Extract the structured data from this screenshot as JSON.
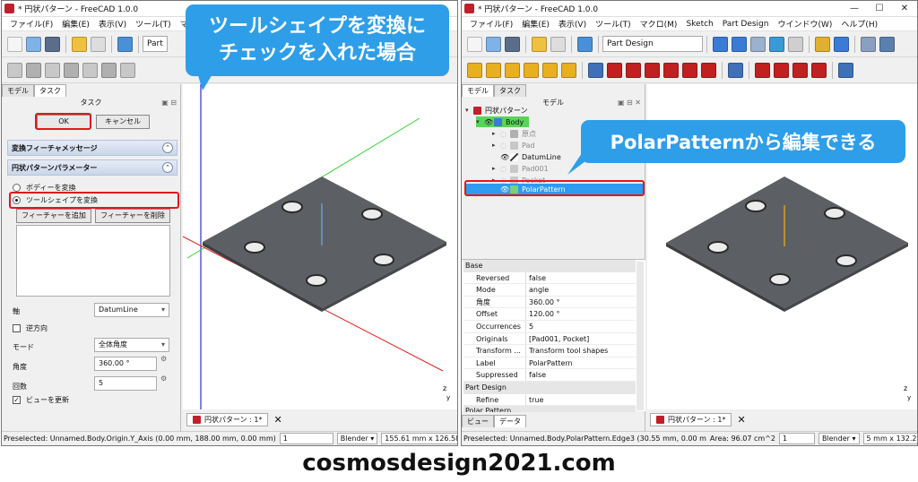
{
  "left": {
    "title": "* 円状パターン - FreeCAD 1.0.0",
    "menu": [
      "ファイル(F)",
      "編集(E)",
      "表示(V)",
      "ツール(T)",
      "マクロ(M)",
      "Sk"
    ],
    "workbench": "Part",
    "tabs": [
      "モデル",
      "タスク"
    ],
    "panel_title": "タスク",
    "ok": "OK",
    "cancel": "キャンセル",
    "section1": "変換フィーチャメッセージ",
    "section2": "円状パターンパラメーター",
    "radio_body": "ボディーを変換",
    "radio_tool": "ツールシェイプを変換",
    "add_feature": "フィーチャーを追加",
    "remove_feature": "フィーチャーを削除",
    "axis_label": "軸",
    "axis_value": "DatumLine",
    "reverse": "逆方向",
    "mode_label": "モード",
    "mode_value": "全体角度",
    "angle_label": "角度",
    "angle_value": "360.00 °",
    "count_label": "回数",
    "count_value": "5",
    "update_view": "ビューを更新",
    "doc_tab": "円状パターン : 1*",
    "status": "Preselected: Unnamed.Body.Origin.Y_Axis (0.00 mm, 188.00 mm, 0.00 mm)",
    "status_combo": "1",
    "nav_style": "Blender",
    "dimensions": "155.61 mm x 126.58 mm",
    "callout": "ツールシェイプを変換に\nチェックを入れた場合"
  },
  "right": {
    "title": "* 円状パターン - FreeCAD 1.0.0",
    "menu": [
      "ファイル(F)",
      "編集(E)",
      "表示(V)",
      "ツール(T)",
      "マクロ(M)",
      "Sketch",
      "Part Design",
      "ウインドウ(W)",
      "ヘルプ(H)"
    ],
    "workbench": "Part Design",
    "tabs": [
      "モデル",
      "タスク"
    ],
    "panel_title": "モデル",
    "tree": {
      "doc": "円状パターン",
      "body": "Body",
      "origin": "原点",
      "pad": "Pad",
      "datum": "DatumLine",
      "pad001": "Pad001",
      "pocket": "Pocket",
      "polar": "PolarPattern"
    },
    "props": {
      "group_base": "Base",
      "rows": [
        {
          "k": "Reversed",
          "v": "false"
        },
        {
          "k": "Mode",
          "v": "angle"
        },
        {
          "k": "角度",
          "v": "360.00 °"
        },
        {
          "k": "Offset",
          "v": "120.00 °"
        },
        {
          "k": "Occurrences",
          "v": "5"
        },
        {
          "k": "Originals",
          "v": "[Pad001, Pocket]"
        },
        {
          "k": "Transform ...",
          "v": "Transform tool shapes"
        },
        {
          "k": "Label",
          "v": "PolarPattern"
        },
        {
          "k": "Suppressed",
          "v": "false"
        }
      ],
      "group_pd": "Part Design",
      "refine_k": "Refine",
      "refine_v": "true",
      "group_polar": "Polar Pattern"
    },
    "bottom_tabs": [
      "ビュー",
      "データ"
    ],
    "doc_tab": "円状パターン : 1*",
    "status": "Preselected: Unnamed.Body.PolarPattern.Edge3 (30.55 mm, 0.00 m",
    "area": "Area: 96.07 cm^2",
    "status_combo": "1",
    "nav_style": "Blender",
    "dimensions": "5 mm x 132.22",
    "callout": "PolarPatternから編集できる"
  },
  "footer": "cosmosdesign2021.com"
}
